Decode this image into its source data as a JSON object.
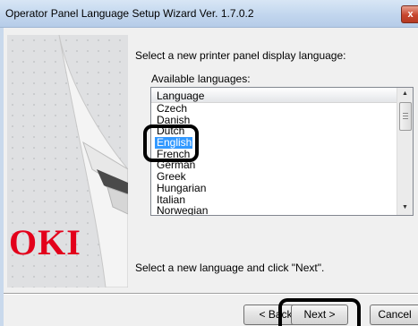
{
  "window": {
    "title": "Operator Panel Language Setup Wizard Ver. 1.7.0.2",
    "close_glyph": "x"
  },
  "art": {
    "logo_text": "OKI"
  },
  "main": {
    "prompt": "Select a new printer panel display language:",
    "available_label": "Available languages:",
    "list_header": "Language",
    "languages": [
      "Czech",
      "Danish",
      "Dutch",
      "English",
      "French",
      "German",
      "Greek",
      "Hungarian",
      "Italian",
      "Norwegian"
    ],
    "selected_language": "English",
    "hint": "Select a new language and click \"Next\"."
  },
  "buttons": {
    "back": "< Back",
    "next": "Next >",
    "cancel": "Cancel"
  },
  "colors": {
    "selection": "#3399ff",
    "highlight_ring": "#000000",
    "logo_red": "#e3001b"
  }
}
